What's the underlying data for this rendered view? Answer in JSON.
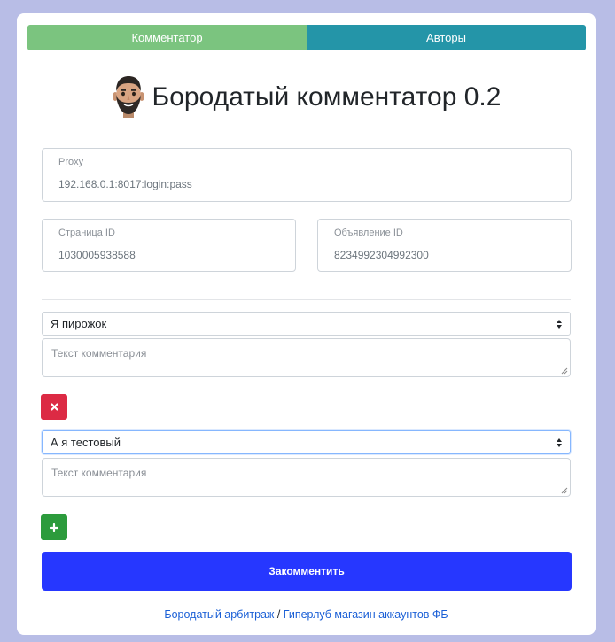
{
  "tabs": [
    {
      "label": "Комментатор",
      "color": "#7bc47f"
    },
    {
      "label": "Авторы",
      "color": "#2495a8"
    }
  ],
  "title": "Бородатый комментатор 0.2",
  "avatar_icon": "bearded-man-emoji",
  "proxy": {
    "label": "Proxy",
    "value": "192.168.0.1:8017:login:pass"
  },
  "page_id": {
    "label": "Страница ID",
    "value": "1030005938588"
  },
  "ad_id": {
    "label": "Объявление ID",
    "value": "8234992304992300"
  },
  "comments": [
    {
      "author": "Я пирожок",
      "placeholder": "Текст комментария",
      "action": "remove",
      "action_icon": "close-icon"
    },
    {
      "author": "А я тестовый",
      "placeholder": "Текст комментария",
      "action": "add",
      "action_icon": "plus-icon"
    }
  ],
  "submit_label": "Закомментить",
  "footer": {
    "link1": "Бородатый арбитраж",
    "separator": " / ",
    "link2": "Гиперлуб магазин аккаунтов ФБ"
  },
  "colors": {
    "page_bg": "#b8bde6",
    "submit": "#2637ff",
    "remove": "#dc2a44",
    "add": "#2c9b3c",
    "link": "#1a5fd6"
  }
}
